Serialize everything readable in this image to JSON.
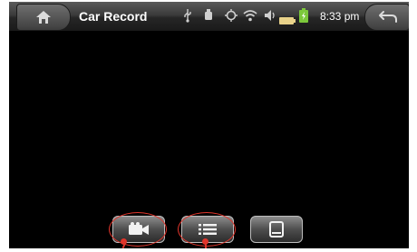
{
  "header": {
    "title": "Car Record",
    "time": "8:33 pm"
  },
  "status_icons": [
    "usb-icon",
    "android-debug-icon",
    "gps-icon",
    "wifi-icon",
    "volume-icon",
    "battery-level-icon",
    "battery-charging-icon"
  ],
  "toolbar": {
    "buttons": [
      "record-video",
      "file-list",
      "gallery"
    ]
  },
  "colors": {
    "screen_bg": "#000000",
    "callout": "#e0352b",
    "battery_green": "#7cc83b"
  }
}
